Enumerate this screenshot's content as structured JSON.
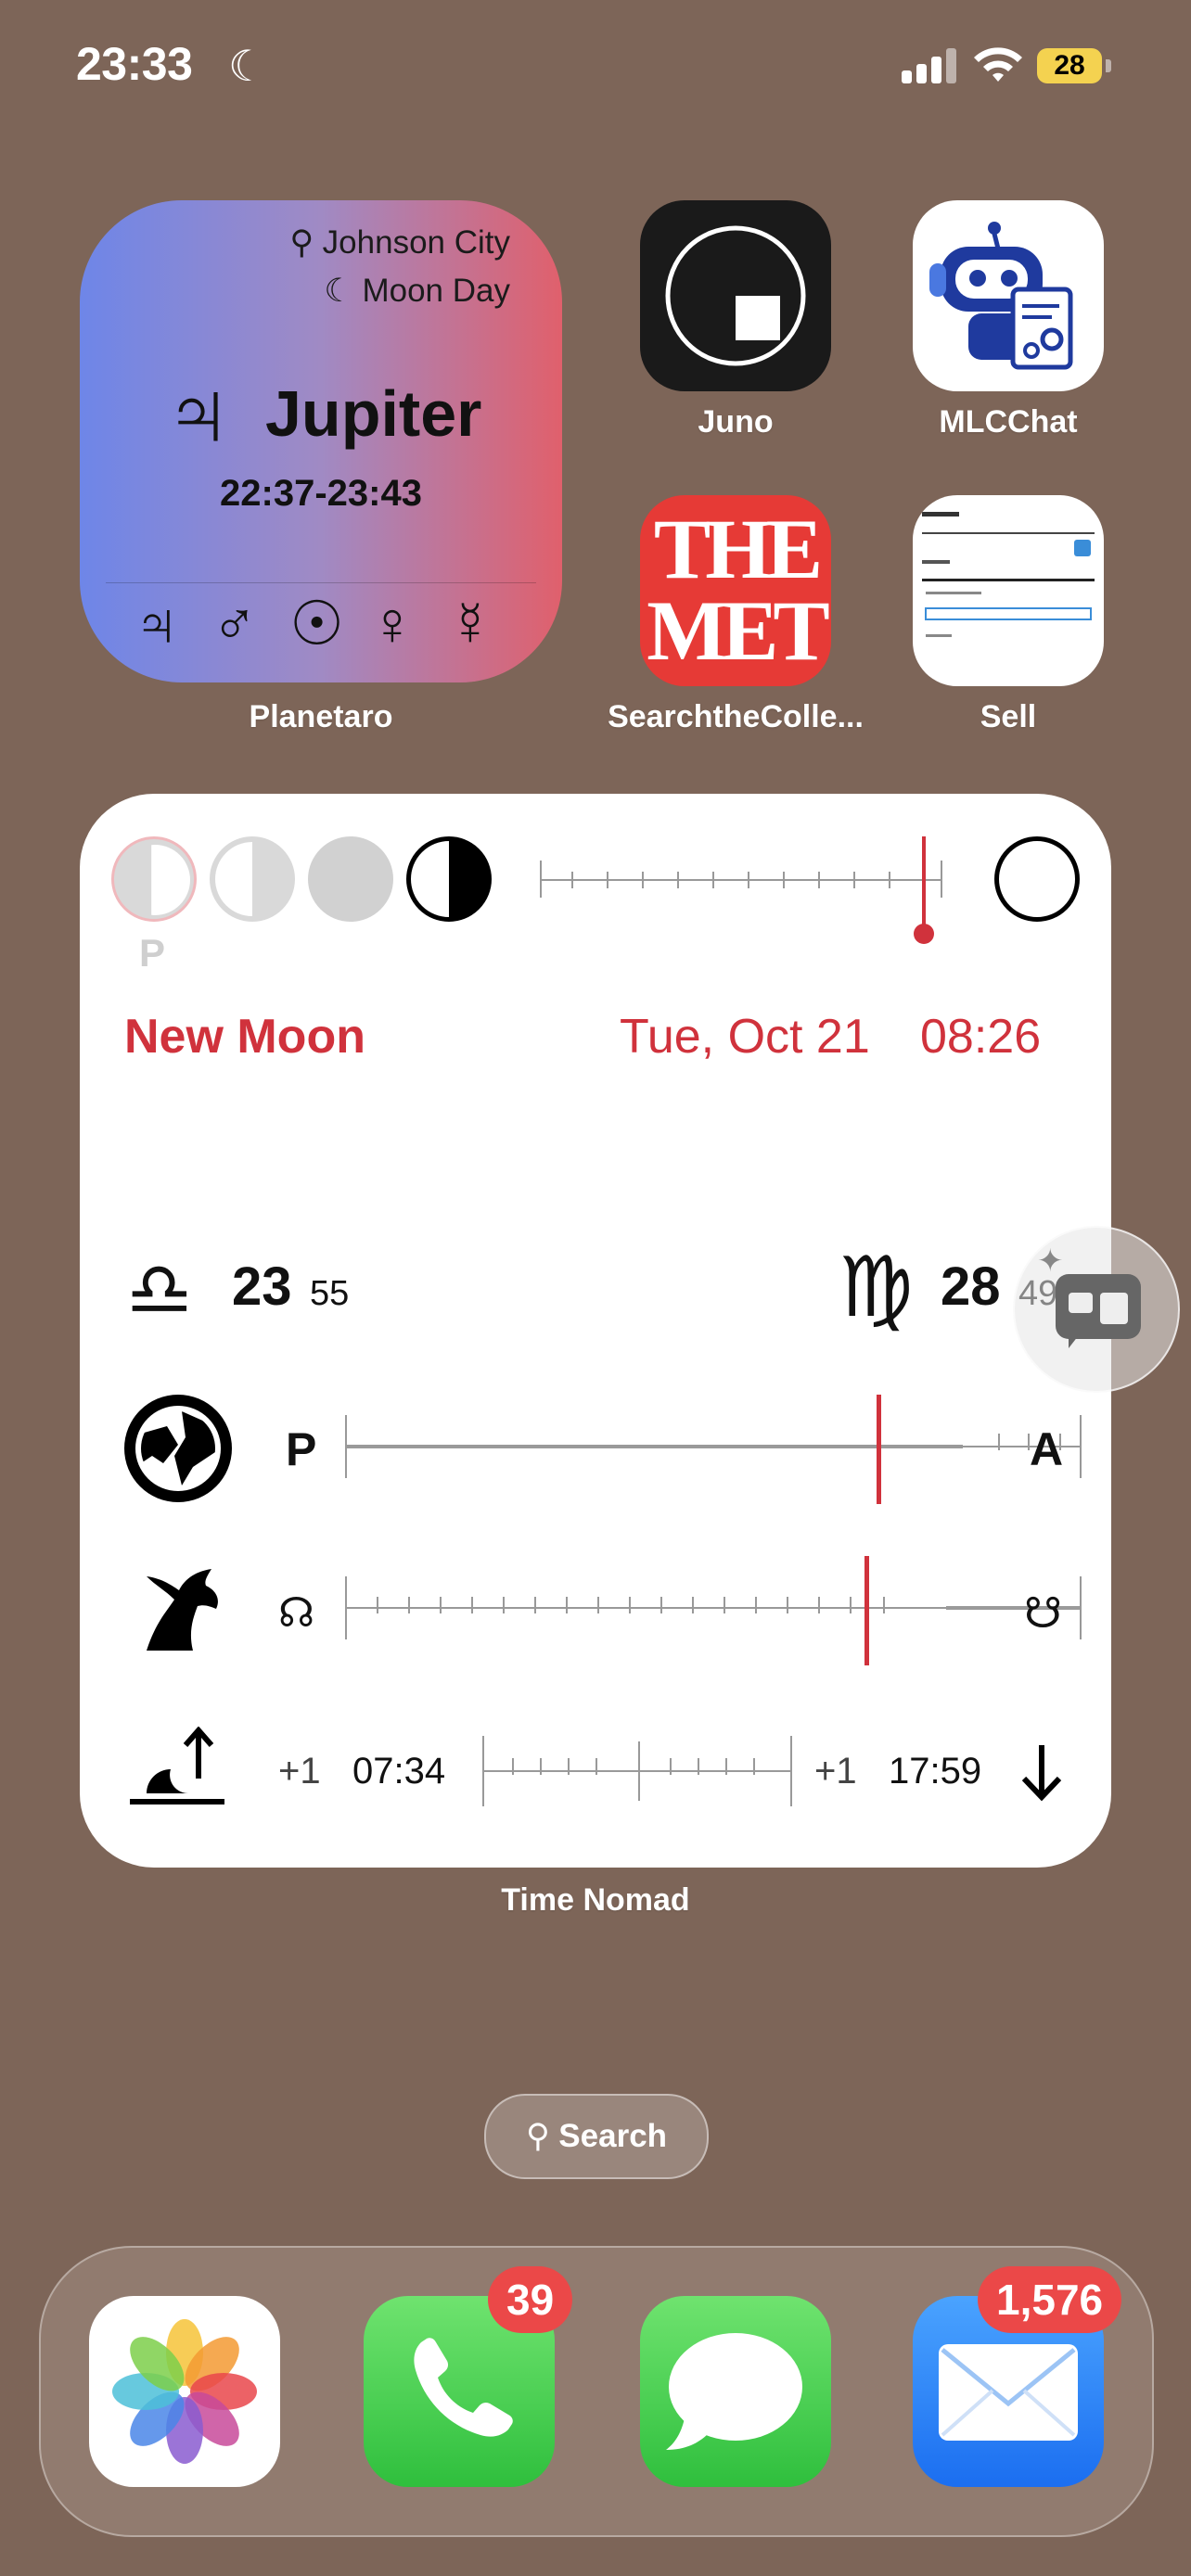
{
  "status_bar": {
    "time": "23:33",
    "battery": "28",
    "icons": [
      "moon-icon",
      "signal-icon",
      "wifi-icon",
      "battery-icon"
    ]
  },
  "planetaro": {
    "location": "Johnson City",
    "day": "Moon Day",
    "planet_symbol": "♃",
    "planet": "Jupiter",
    "range": "22:37-23:43",
    "symbols": [
      "♃",
      "♂",
      "☉",
      "♀",
      "☿"
    ],
    "label": "Planetaro"
  },
  "apps": {
    "juno": {
      "label": "Juno"
    },
    "mlcchat": {
      "label": "MLCChat"
    },
    "met": {
      "label": "SearchtheColle...",
      "logo_line1": "THE",
      "logo_line2": "MET"
    },
    "sell": {
      "label": "Sell"
    }
  },
  "time_nomad": {
    "label": "Time Nomad",
    "phase_letter": "P",
    "event": "New Moon",
    "event_date": "Tue, Oct 21",
    "event_time": "08:26",
    "sun_sign": "♎",
    "sun_deg": "23",
    "sun_min": "55",
    "moon_sign": "♍",
    "moon_deg": "28",
    "moon_min": "49",
    "perigee": "P",
    "apogee": "A",
    "node_north": "☊",
    "node_south": "☋",
    "sunrise_offset": "+1",
    "sunrise": "07:34",
    "sunset_offset": "+1",
    "sunset": "17:59",
    "perigee_progress": 0.82,
    "node_progress": 0.79
  },
  "search": {
    "label": "Search"
  },
  "dock": {
    "phone_badge": "39",
    "mail_badge": "1,576"
  },
  "colors": {
    "accent_red": "#d0323c",
    "wallpaper": "#7d6558"
  }
}
